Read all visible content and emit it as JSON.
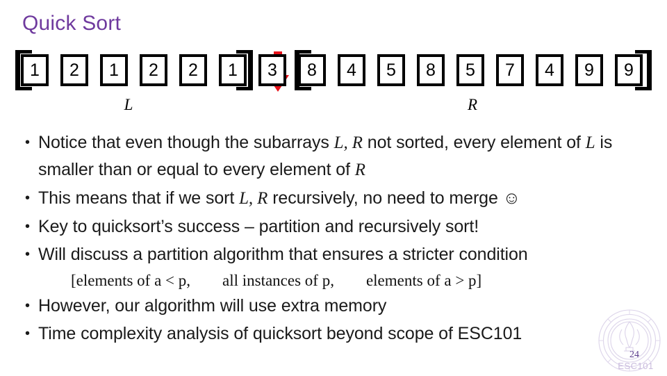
{
  "slide": {
    "title": "Quick Sort",
    "title_color": "#6f3a9e",
    "background": "#ffffff"
  },
  "array": {
    "cells": [
      {
        "value": "1",
        "group": "L"
      },
      {
        "value": "2",
        "group": "L"
      },
      {
        "value": "1",
        "group": "L"
      },
      {
        "value": "2",
        "group": "L"
      },
      {
        "value": "2",
        "group": "L"
      },
      {
        "value": "1",
        "group": "L"
      },
      {
        "value": "3",
        "group": "pivot"
      },
      {
        "value": "8",
        "group": "R"
      },
      {
        "value": "4",
        "group": "R"
      },
      {
        "value": "5",
        "group": "R"
      },
      {
        "value": "8",
        "group": "R"
      },
      {
        "value": "5",
        "group": "R"
      },
      {
        "value": "7",
        "group": "R"
      },
      {
        "value": "4",
        "group": "R"
      },
      {
        "value": "9",
        "group": "R"
      },
      {
        "value": "9",
        "group": "R"
      }
    ],
    "labels": {
      "left_subarray": "L",
      "right_subarray": "R"
    },
    "pivot": {
      "value": "3",
      "index": 6,
      "marker_color": "#e8121a"
    }
  },
  "bullets": [
    {
      "dot": "•",
      "segments": [
        {
          "t": "Notice that even though the subarrays ",
          "style": "plain"
        },
        {
          "t": "L, R",
          "style": "math"
        },
        {
          "t": " not sorted, every element of ",
          "style": "plain"
        },
        {
          "t": "L",
          "style": "math"
        },
        {
          "t": " is smaller than or equal to every element of ",
          "style": "plain"
        },
        {
          "t": "R",
          "style": "math"
        }
      ]
    },
    {
      "dot": "•",
      "segments": [
        {
          "t": "This means that if we sort ",
          "style": "plain"
        },
        {
          "t": "L, R",
          "style": "math"
        },
        {
          "t": " recursively, no need to merge ",
          "style": "plain"
        },
        {
          "t": "☺",
          "style": "smiley"
        }
      ]
    },
    {
      "dot": "•",
      "segments": [
        {
          "t": "Key to quicksort’s success – partition and recursively sort!",
          "style": "plain"
        }
      ]
    },
    {
      "dot": "•",
      "segments": [
        {
          "t": "Will discuss a partition algorithm that ensures a stricter condition",
          "style": "plain"
        }
      ],
      "sub_line": "[elements of a < p,        all instances of p,        elements of a > p]"
    },
    {
      "dot": "•",
      "segments": [
        {
          "t": "However, our algorithm will use extra memory",
          "style": "plain"
        }
      ]
    },
    {
      "dot": "•",
      "segments": [
        {
          "t": "Time complexity analysis of quicksort beyond scope of ESC101",
          "style": "plain"
        }
      ]
    }
  ],
  "footer": {
    "page_number": "24",
    "course_code": "ESC101",
    "logo": "institute-seal-watermark"
  }
}
